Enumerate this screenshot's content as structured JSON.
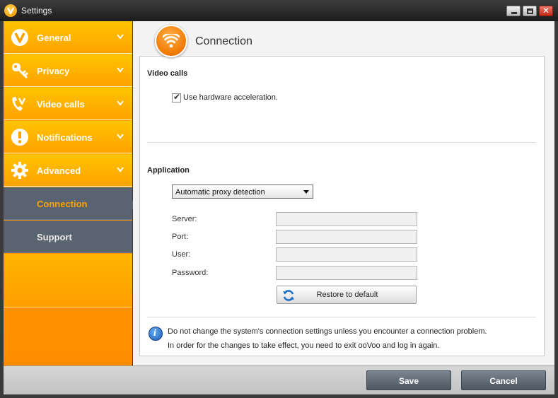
{
  "window": {
    "title": "Settings"
  },
  "sidebar": {
    "items": [
      {
        "label": "General",
        "icon": "oovoo-logo-icon"
      },
      {
        "label": "Privacy",
        "icon": "key-icon"
      },
      {
        "label": "Video calls",
        "icon": "video-call-icon"
      },
      {
        "label": "Notifications",
        "icon": "exclamation-icon"
      },
      {
        "label": "Advanced",
        "icon": "gear-icon"
      }
    ],
    "subitems": [
      {
        "label": "Connection",
        "active": true
      },
      {
        "label": "Support",
        "active": false
      }
    ]
  },
  "page": {
    "title": "Connection",
    "icon": "wifi-icon"
  },
  "video_calls": {
    "title": "Video calls",
    "hw_accel_label": "Use hardware acceleration.",
    "hw_accel_checked": true
  },
  "application": {
    "title": "Application",
    "proxy_selected": "Automatic proxy detection",
    "fields": [
      {
        "label": "Server:",
        "value": ""
      },
      {
        "label": "Port:",
        "value": ""
      },
      {
        "label": "User:",
        "value": ""
      },
      {
        "label": "Password:",
        "value": ""
      }
    ],
    "restore_label": "Restore to default"
  },
  "info": {
    "line1": "Do not change the system's connection settings unless you encounter a connection problem.",
    "line2": "In order for the changes to take effect, you need to exit ooVoo and log in again."
  },
  "footer": {
    "save_label": "Save",
    "cancel_label": "Cancel"
  },
  "colors": {
    "accent": "#ffa200",
    "sidebar_dark": "#5a6470",
    "button": "#5d6772"
  }
}
